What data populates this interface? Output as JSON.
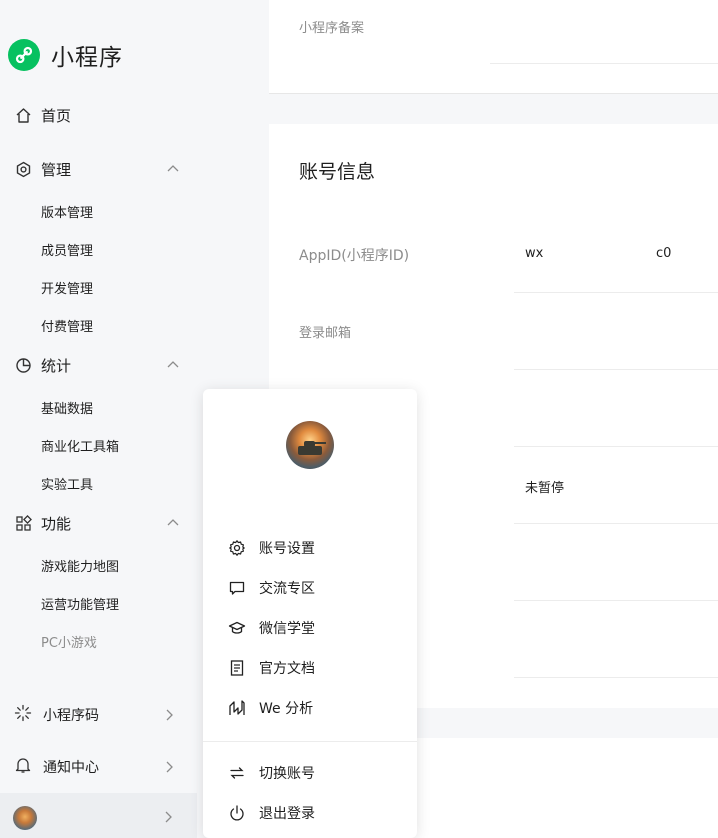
{
  "brand": {
    "title": "小程序",
    "color": "#07c160"
  },
  "sidebar": {
    "home": "首页",
    "manage": {
      "label": "管理",
      "items": [
        "版本管理",
        "成员管理",
        "开发管理",
        "付费管理"
      ]
    },
    "stats": {
      "label": "统计",
      "items": [
        "基础数据",
        "商业化工具箱",
        "实验工具"
      ]
    },
    "features": {
      "label": "功能",
      "items": [
        "游戏能力地图",
        "运营功能管理",
        "PC小游戏"
      ]
    },
    "qrcode": "小程序码",
    "notifications": "通知中心"
  },
  "main": {
    "top_field_label": "小程序备案",
    "account": {
      "title": "账号信息",
      "appid_label": "AppID(小程序ID)",
      "appid_prefix": "wx",
      "appid_suffix": "c0",
      "email_label": "登录邮箱",
      "status_value": "未暂停"
    }
  },
  "popover": {
    "menu": {
      "settings": "账号设置",
      "community": "交流专区",
      "academy": "微信学堂",
      "docs": "官方文档",
      "analysis": "We 分析"
    },
    "switch_account": "切换账号",
    "logout": "退出登录"
  }
}
